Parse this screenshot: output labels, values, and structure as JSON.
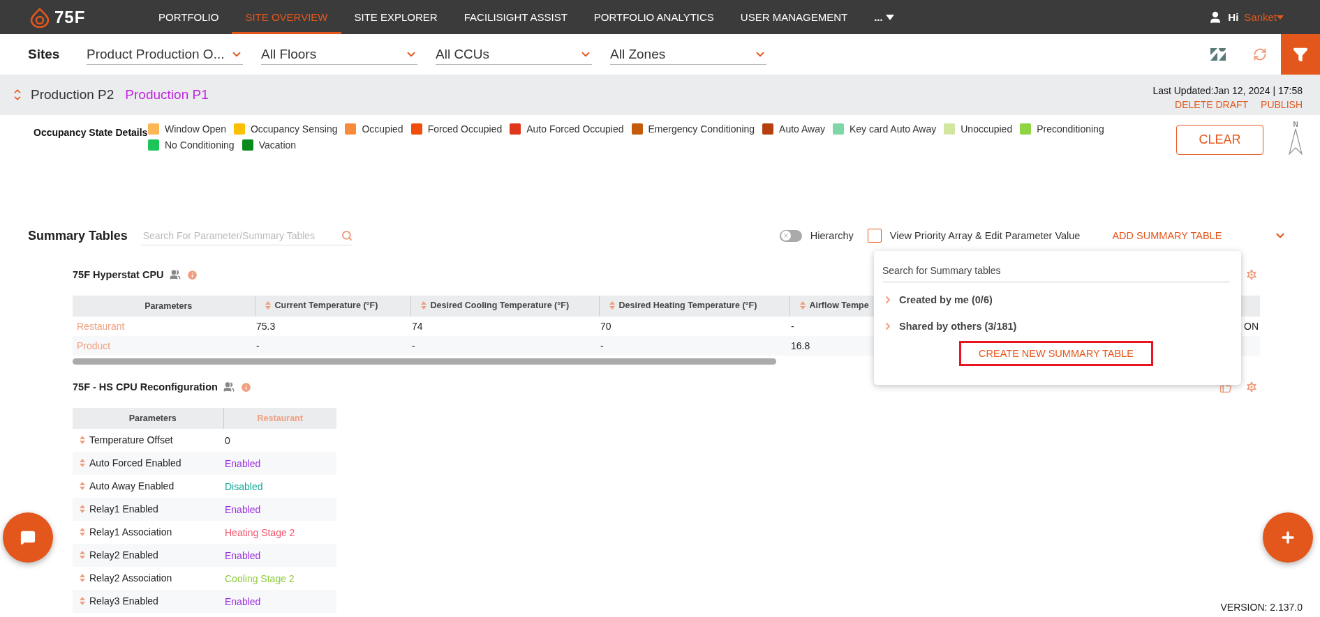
{
  "nav": {
    "logo": "75F",
    "items": [
      {
        "label": "PORTFOLIO",
        "selected": false
      },
      {
        "label": "SITE OVERVIEW",
        "selected": true
      },
      {
        "label": "SITE EXPLORER",
        "selected": false
      },
      {
        "label": "FACILISIGHT ASSIST",
        "selected": false
      },
      {
        "label": "PORTFOLIO ANALYTICS",
        "selected": false
      },
      {
        "label": "USER MANAGEMENT",
        "selected": false
      }
    ],
    "more": "...",
    "greeting": "Hi",
    "user": "Sanket"
  },
  "filters": {
    "title": "Sites",
    "dropdowns": [
      "Product Production O...",
      "All Floors",
      "All CCUs",
      "All Zones"
    ]
  },
  "header_bar": {
    "zones": [
      {
        "label": "Production P2",
        "highlighted": false
      },
      {
        "label": "Production P1",
        "highlighted": true
      }
    ],
    "last_updated": "Last Updated:Jan 12, 2024 | 17:58",
    "actions": [
      "DELETE DRAFT",
      "PUBLISH"
    ]
  },
  "legend": {
    "title": "Occupancy State Details",
    "items": [
      {
        "label": "Window Open",
        "color": "#fbb655"
      },
      {
        "label": "Occupancy Sensing",
        "color": "#fcc000"
      },
      {
        "label": "Occupied",
        "color": "#f98a3a"
      },
      {
        "label": "Forced Occupied",
        "color": "#f04e0a"
      },
      {
        "label": "Auto Forced Occupied",
        "color": "#e0361b"
      },
      {
        "label": "Emergency Conditioning",
        "color": "#c45a0b"
      },
      {
        "label": "Auto Away",
        "color": "#b5400f"
      },
      {
        "label": "Key card Auto Away",
        "color": "#7fd6a9"
      },
      {
        "label": "Unoccupied",
        "color": "#d2e6a0"
      },
      {
        "label": "Preconditioning",
        "color": "#8fd443"
      },
      {
        "label": "No Conditioning",
        "color": "#1cc45a"
      },
      {
        "label": "Vacation",
        "color": "#0a8a1c"
      }
    ],
    "clear": "CLEAR",
    "north": "N"
  },
  "summary": {
    "title": "Summary Tables",
    "search_placeholder": "Search For Parameter/Summary Tables",
    "hierarchy": {
      "label": "Hierarchy",
      "on": false
    },
    "priority": {
      "label": "View Priority Array & Edit Parameter Value",
      "checked": false
    },
    "add": "ADD SUMMARY TABLE"
  },
  "popup": {
    "placeholder": "Search for Summary tables",
    "groups": [
      {
        "label": "Created by me (0/6)",
        "expanded": false
      },
      {
        "label": "Shared by others (3/181)",
        "expanded": false
      }
    ],
    "create": "CREATE NEW SUMMARY TABLE"
  },
  "tables": [
    {
      "kind": "wide",
      "title": "75F Hyperstat CPU",
      "columns": [
        "Parameters",
        "Current Temperature  (°F)",
        "Desired Cooling Temperature  (°F)",
        "Desired Heating Temperature  (°F)",
        "Airflow Tempe"
      ],
      "rows": [
        {
          "cells": [
            "Restaurant",
            "75.3",
            "74",
            "70",
            "-"
          ],
          "tail": "ON"
        },
        {
          "cells": [
            "Product",
            "-",
            "-",
            "-",
            "16.8"
          ]
        }
      ]
    },
    {
      "kind": "tall",
      "title": "75F - HS CPU Reconfiguration",
      "columns": [
        "Parameters",
        "Restaurant"
      ],
      "rows": [
        {
          "label": "Temperature Offset",
          "value": "0",
          "color": "#222222"
        },
        {
          "label": "Auto Forced Enabled",
          "value": "Enabled",
          "color": "#9b30e0"
        },
        {
          "label": "Auto Away Enabled",
          "value": "Disabled",
          "color": "#19a89a"
        },
        {
          "label": "Relay1 Enabled",
          "value": "Enabled",
          "color": "#9b30e0"
        },
        {
          "label": "Relay1 Association",
          "value": "Heating Stage 2",
          "color": "#f0566a"
        },
        {
          "label": "Relay2 Enabled",
          "value": "Enabled",
          "color": "#9b30e0"
        },
        {
          "label": "Relay2 Association",
          "value": "Cooling Stage 2",
          "color": "#8ccc3a"
        },
        {
          "label": "Relay3 Enabled",
          "value": "Enabled",
          "color": "#9b30e0"
        }
      ]
    }
  ],
  "version": "VERSION: 2.137.0"
}
